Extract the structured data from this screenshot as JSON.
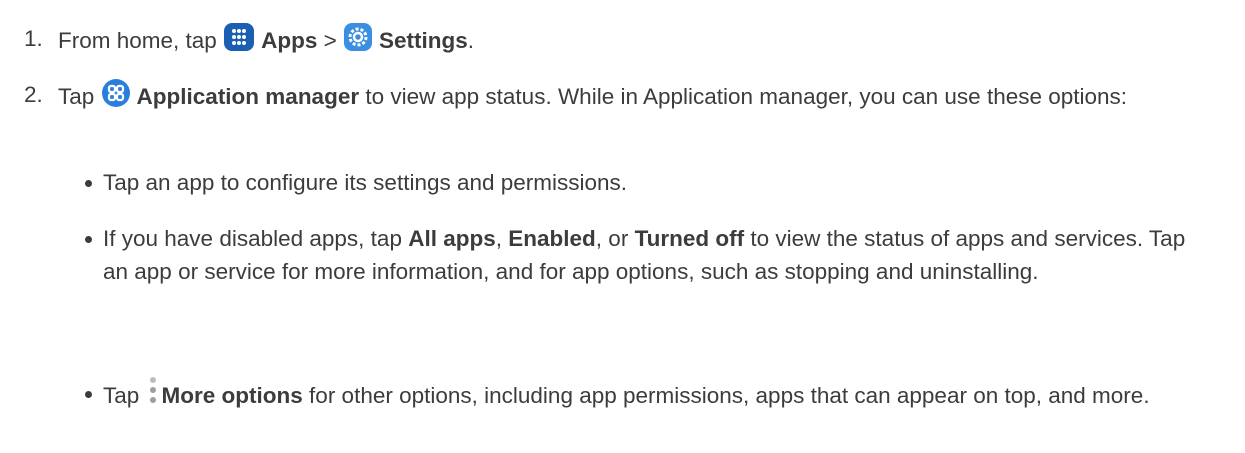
{
  "steps": [
    {
      "number": "1.",
      "t1": "From home, tap",
      "b1": "Apps",
      "t2": " > ",
      "b2": "Settings",
      "t3": "."
    },
    {
      "number": "2.",
      "t1": "Tap",
      "b1": "Application manager",
      "t2": " to view app status. While in Application manager, you can use these options:"
    }
  ],
  "bullets": [
    {
      "text": "Tap an app to configure its settings and permissions."
    },
    {
      "t1": "If you have disabled apps, tap ",
      "b1": "All apps",
      "t2": ", ",
      "b2": "Enabled",
      "t3": ", or ",
      "b3": "Turned off",
      "t4": " to view the status of apps and services. Tap an app or service for more information, and for app options, such as stopping and uninstalling."
    },
    {
      "t1": "Tap",
      "b1": "More options",
      "t2": " for other options, including app permissions, apps that can appear on top, and more."
    }
  ],
  "icons": {
    "apps": "apps-grid-icon",
    "settings": "settings-gear-icon",
    "application_manager": "application-manager-icon",
    "more_options": "more-options-icon"
  },
  "colors": {
    "text": "#3c3c3c",
    "apps_icon_bg": "#1a5fb4",
    "settings_icon_bg": "#3b8fe0",
    "app_manager_icon_bg": "#2a7fde"
  }
}
